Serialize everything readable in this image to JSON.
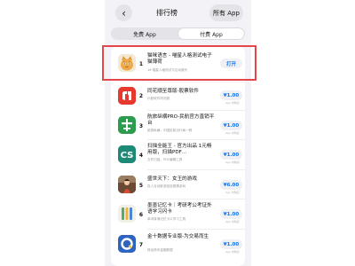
{
  "header": {
    "title": "排行榜",
    "all_apps": "所有 App"
  },
  "segments": {
    "free": "免费 App",
    "paid": "付费 App"
  },
  "apps": [
    {
      "rank": "1",
      "name": "猫咪语言 - 喵星人格测试电子猫薄荷",
      "subtitle": "16 喵星人格测试与互动娱乐",
      "button": "打开",
      "iap": ""
    },
    {
      "rank": "2",
      "name": "同花顺至尊版-股票软件",
      "subtitle": "炒股软件同花顺",
      "button": "¥1.00",
      "iap": "App 内购买"
    },
    {
      "rank": "3",
      "name": "航旅纵横PRO-民航官方直销平台",
      "subtitle": "航旅纵横，中国民航出行每一程",
      "button": "¥1.00",
      "iap": "App 内购买"
    },
    {
      "rank": "4",
      "name": "扫描全能王 - 官方出品 1元畅用版，扫描PDF…",
      "subtitle": "文件扫描、PDF编辑工具",
      "button": "¥1.00",
      "iap": "App 内购买"
    },
    {
      "rank": "5",
      "name": "盛世天下：女王的游戏",
      "subtitle": "真人互动影游宫廷剧情游戏",
      "button": "¥6.00",
      "iap": "App 内购买"
    },
    {
      "rank": "6",
      "name": "墨墨记忆卡｜考研考公考证外语学习闪卡",
      "subtitle": "单词背诵记忆卡片学习工具",
      "button": "¥1.00",
      "iap": "App 内购买"
    },
    {
      "rank": "7",
      "name": "金十数据专业版-为交易而生",
      "subtitle": "财经资讯金融数据",
      "button": "¥1.00",
      "iap": "App 内购买"
    }
  ]
}
